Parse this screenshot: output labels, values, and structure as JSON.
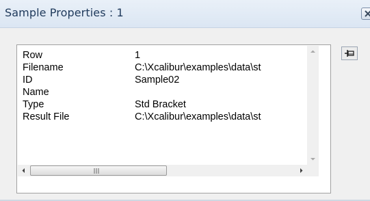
{
  "window": {
    "title": "Sample Properties : 1"
  },
  "properties": [
    {
      "name": "Row",
      "value": "1"
    },
    {
      "name": "Filename",
      "value": "C:\\Xcalibur\\examples\\data\\st"
    },
    {
      "name": "ID",
      "value": "Sample02"
    },
    {
      "name": "Name",
      "value": ""
    },
    {
      "name": "Type",
      "value": "Std Bracket"
    },
    {
      "name": "Result File",
      "value": "C:\\Xcalibur\\examples\\data\\st"
    }
  ],
  "icons": {
    "close": "close-icon",
    "pin": "pin-icon",
    "scroll_up": "arrow-up-icon",
    "scroll_down": "arrow-down-icon",
    "scroll_left": "arrow-left-icon",
    "scroll_right": "arrow-right-icon"
  },
  "colors": {
    "titlebar": "#dbe6f3",
    "title_text": "#1e395b",
    "panel_background": "#ffffff",
    "dialog_background": "#f0f0f0"
  }
}
